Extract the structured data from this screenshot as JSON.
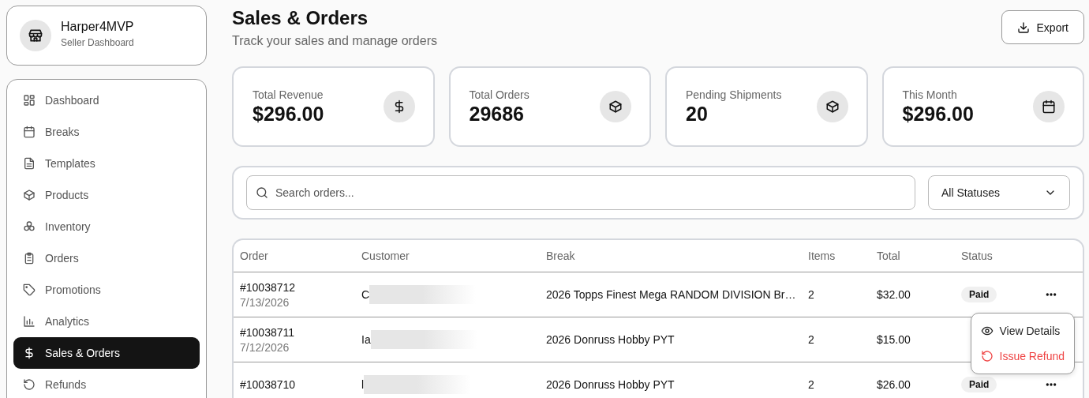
{
  "profile": {
    "name": "Harper4MVP",
    "subtitle": "Seller Dashboard"
  },
  "nav": [
    {
      "label": "Dashboard",
      "selected": false
    },
    {
      "label": "Breaks",
      "selected": false
    },
    {
      "label": "Templates",
      "selected": false
    },
    {
      "label": "Products",
      "selected": false
    },
    {
      "label": "Inventory",
      "selected": false
    },
    {
      "label": "Orders",
      "selected": false
    },
    {
      "label": "Promotions",
      "selected": false
    },
    {
      "label": "Analytics",
      "selected": false
    },
    {
      "label": "Sales & Orders",
      "selected": true
    },
    {
      "label": "Refunds",
      "selected": false
    }
  ],
  "header": {
    "title": "Sales & Orders",
    "subtitle": "Track your sales and manage orders",
    "export_button": "Export"
  },
  "stats": [
    {
      "label": "Total Revenue",
      "value": "$296.00"
    },
    {
      "label": "Total Orders",
      "value": "29686"
    },
    {
      "label": "Pending Shipments",
      "value": "20"
    },
    {
      "label": "This Month",
      "value": "$296.00"
    }
  ],
  "filters": {
    "search": {
      "placeholder": "Search orders..."
    },
    "status_select": "All Statuses"
  },
  "table": {
    "columns": [
      "Order",
      "Customer",
      "Break",
      "Items",
      "Total",
      "Status"
    ],
    "rows": [
      {
        "order": "#10038712",
        "date": "7/13/2026",
        "customer": "C",
        "break": "2026 Topps Finest Mega RANDOM DIVISION Br…",
        "items": "2",
        "total": "$32.00",
        "status": "Paid"
      },
      {
        "order": "#10038711",
        "date": "7/12/2026",
        "customer": "Ia",
        "break": "2026 Donruss Hobby PYT",
        "items": "2",
        "total": "$15.00"
      },
      {
        "order": "#10038710",
        "customer": "l",
        "break": "2026 Donruss Hobby PYT",
        "items": "2",
        "total": "$26.00",
        "status": "Paid"
      }
    ]
  },
  "row_menu": [
    {
      "label": "View Details",
      "kind": "default"
    },
    {
      "label": "Issue Refund",
      "kind": "danger"
    }
  ]
}
